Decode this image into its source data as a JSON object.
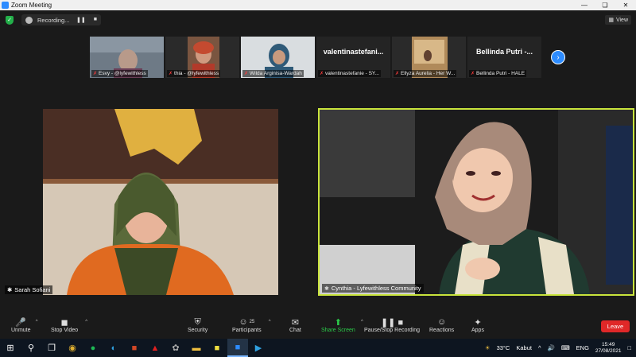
{
  "window": {
    "title": "Zoom Meeting"
  },
  "topbar": {
    "recording_label": "Recording...",
    "pause_icon": "pause-icon",
    "stop_icon": "stop-icon",
    "view_label": "View"
  },
  "thumbnails": [
    {
      "name": "Esvy - @lyfewithless",
      "has_video": true,
      "bg": "#5a6470"
    },
    {
      "name": "thia - @lyfewithless",
      "has_video": true,
      "bg": "#6b4a3a"
    },
    {
      "name": "Wilda Arginisa-Wardah",
      "has_video": true,
      "bg": "#3f5966"
    },
    {
      "name": "valentinastefanie - SY...",
      "has_video": false,
      "card": "valentinastefani..."
    },
    {
      "name": "Ellyza Aurelia - Her W...",
      "has_video": true,
      "bg": "#8a6a4a"
    },
    {
      "name": "Bellinda Putri - HALE",
      "has_video": false,
      "card": "Bellinda Putri -..."
    }
  ],
  "speakers": {
    "left": {
      "name": "Sarah Sofiani"
    },
    "right": {
      "name": "Cynthia - Lyfewithless Community"
    }
  },
  "toolbar": {
    "unmute": "Unmute",
    "stop_video": "Stop Video",
    "security": "Security",
    "participants": "Participants",
    "participants_count": "25",
    "chat": "Chat",
    "share_screen": "Share Screen",
    "pause_stop_recording": "Pause/Stop Recording",
    "reactions": "Reactions",
    "apps": "Apps",
    "leave": "Leave"
  },
  "taskbar": {
    "weather": "33°C",
    "weather_desc": "Kabut",
    "lang": "ENG",
    "time": "15:49",
    "date": "27/08/2021"
  },
  "colors": {
    "accent": "#2d8cff",
    "active_speaker_border": "#c9e43c",
    "leave": "#e02828",
    "share": "#2bcc4a"
  }
}
